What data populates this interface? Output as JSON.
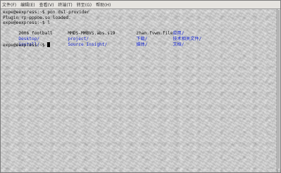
{
  "menu": {
    "items": [
      "文件(F)",
      "编辑(E)",
      "查看(V)",
      "终端(T)",
      "转至(G)",
      "帮助(H)"
    ]
  },
  "terminal": {
    "lines": [
      "expe@eexpress:~$ pon dsl-provider",
      "Plugin rp-pppoe.so loaded.",
      "expe@eexpress:~$ l"
    ],
    "listing": [
      [
        {
          "text": "2006 football",
          "dir": false
        },
        {
          "text": "MMDS-MMBVS.abs.s19",
          "dir": false
        },
        {
          "text": "zhan.fvwm.file",
          "dir": false
        },
        {
          "text": "应用/",
          "dir": true
        }
      ],
      [
        {
          "text": "Desktop/",
          "dir": true
        },
        {
          "text": "project/",
          "dir": true
        },
        {
          "text": "下载/",
          "dir": true
        },
        {
          "text": "技术相关文件/",
          "dir": true
        }
      ],
      [
        {
          "text": "install/",
          "dir": true
        },
        {
          "text": "Source Insight/",
          "dir": true
        },
        {
          "text": "媒体/",
          "dir": true
        },
        {
          "text": "文档/",
          "dir": true
        }
      ]
    ],
    "prompt": "expe@eexpress:~$ "
  },
  "colors": {
    "directory": "#1a2bd6",
    "text": "#111111"
  }
}
